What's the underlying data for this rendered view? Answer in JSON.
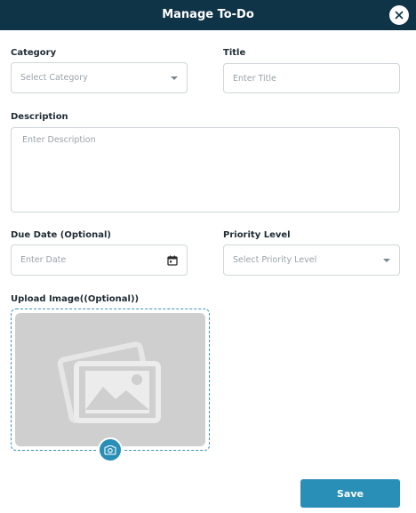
{
  "modal": {
    "title": "Manage To-Do",
    "close_icon": "close-icon"
  },
  "form": {
    "category": {
      "label": "Category",
      "placeholder": "Select Category"
    },
    "title": {
      "label": "Title",
      "placeholder": "Enter Title"
    },
    "description": {
      "label": "Description",
      "placeholder": "Enter Description"
    },
    "due_date": {
      "label": "Due Date (Optional)",
      "placeholder": "Enter Date",
      "icon": "calendar-icon"
    },
    "priority": {
      "label": "Priority Level",
      "placeholder": "Select Priority Level"
    },
    "upload": {
      "label": "Upload Image((Optional))",
      "preview_icon": "image-placeholder-icon",
      "camera_icon": "camera-icon"
    }
  },
  "actions": {
    "save_label": "Save"
  },
  "colors": {
    "header_bg": "#0f3347",
    "accent": "#2a8fb7",
    "upload_border": "#3b93b8",
    "placeholder_bg": "#cfcfcf"
  }
}
